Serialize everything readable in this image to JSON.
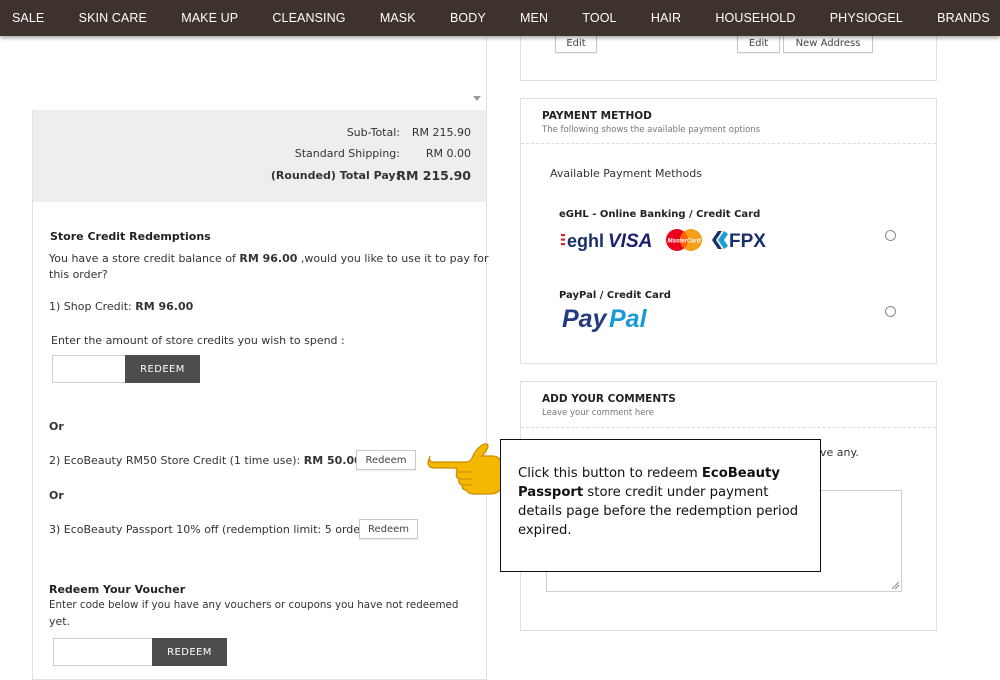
{
  "nav": {
    "items": [
      "SALE",
      "SKIN CARE",
      "MAKE UP",
      "CLEANSING",
      "MASK",
      "BODY",
      "MEN",
      "TOOL",
      "HAIR",
      "HOUSEHOLD",
      "PHYSIOGEL",
      "BRANDS"
    ]
  },
  "totals": {
    "subtotal_label": "Sub-Total:",
    "subtotal_value": "RM 215.90",
    "shipping_label": "Standard Shipping:",
    "shipping_value": "RM 0.00",
    "total_label": "(Rounded) Total Pay:",
    "total_value": "RM 215.90"
  },
  "store_credit": {
    "title": "Store Credit Redemptions",
    "balance_prefix": "You have a store credit balance of ",
    "balance_value": "RM 96.00",
    "balance_suffix": " ,would you like to use it to pay for",
    "balance_line2": "this order?",
    "shop_credit_label": "1) Shop Credit: ",
    "shop_credit_value": "RM 96.00",
    "enter_amount_label": "Enter the amount of store credits you wish to spend :",
    "redeem_button": "REDEEM",
    "or_1": "Or",
    "option2_label": "2) EcoBeauty RM50 Store Credit (1 time use): ",
    "option2_value": "RM 50.00",
    "option2_button": "Redeem",
    "or_2": "Or",
    "option3_label": "3) EcoBeauty Passport 10% off (redemption limit: 5 orders)",
    "option3_button": "Redeem"
  },
  "voucher": {
    "title": "Redeem Your Voucher",
    "desc_line1": "Enter code below if you have any vouchers or coupons you have not redeemed",
    "desc_line2": "yet.",
    "redeem_button": "REDEEM"
  },
  "address": {
    "edit_button_1": "Edit",
    "edit_button_2": "Edit",
    "new_address_button": "New Address"
  },
  "payment": {
    "title": "PAYMENT METHOD",
    "subtitle": "The following shows the available payment options",
    "available_label": "Available Payment Methods",
    "method1_name": "eGHL - Online Banking / Credit Card",
    "method1_logos": {
      "eghl": "eghl",
      "visa": "VISA",
      "mastercard": "MasterCard",
      "fpx": "FPX"
    },
    "method2_name": "PayPal / Credit Card",
    "method2_logo": {
      "pay": "Pay",
      "pal": "Pal"
    }
  },
  "comments": {
    "title": "ADD YOUR COMMENTS",
    "subtitle": "Leave your comment here",
    "partial_text": "ve any."
  },
  "callout": {
    "text_1": "Click this button to redeem ",
    "text_bold": "EcoBeauty Passport",
    "text_2": " store credit under payment details page before the redemption period expired."
  },
  "icons": {
    "pointer": "pointing-hand-icon",
    "dropdown": "scroll-down-arrow-icon"
  },
  "colors": {
    "nav_bg": "#3d322c",
    "button_dark": "#4d4d4d",
    "visa_blue": "#1a1f71",
    "paypal_dark": "#253b80",
    "paypal_light": "#179bd7",
    "mastercard_red": "#eb001b",
    "mastercard_orange": "#f79e1b",
    "eghl_red": "#e31e24",
    "fpx_navy": "#1b2f6b",
    "hand_yellow": "#f5b800"
  }
}
